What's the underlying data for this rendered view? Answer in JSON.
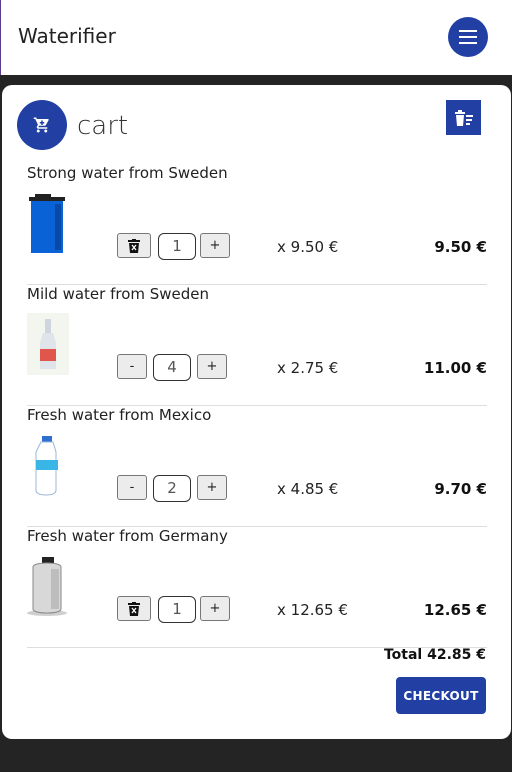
{
  "app": {
    "title": "Waterifier"
  },
  "cart": {
    "title": "cart",
    "items": [
      {
        "name": "Strong water from Sweden",
        "quantity": "1",
        "left_control": "delete",
        "increment_label": "+",
        "unit_price": "x 9.50 €",
        "line_total": "9.50 €"
      },
      {
        "name": "Mild water from Sweden",
        "quantity": "4",
        "left_control": "decrement",
        "decrement_label": "-",
        "increment_label": "+",
        "unit_price": "x 2.75 €",
        "line_total": "11.00 €"
      },
      {
        "name": "Fresh water from Mexico",
        "quantity": "2",
        "left_control": "decrement",
        "decrement_label": "-",
        "increment_label": "+",
        "unit_price": "x 4.85 €",
        "line_total": "9.70 €"
      },
      {
        "name": "Fresh water from Germany",
        "quantity": "1",
        "left_control": "delete",
        "increment_label": "+",
        "unit_price": "x 12.65 €",
        "line_total": "12.65 €"
      }
    ],
    "total": "Total 42.85 €",
    "checkout_label": "CHECKOUT"
  },
  "colors": {
    "primary": "#2240a4",
    "background": "#242424",
    "surface": "#ffffff"
  },
  "icons": {
    "menu": "menu-icon",
    "cart": "cart-icon",
    "clear": "clear-cart-icon",
    "delete": "trash-icon"
  }
}
